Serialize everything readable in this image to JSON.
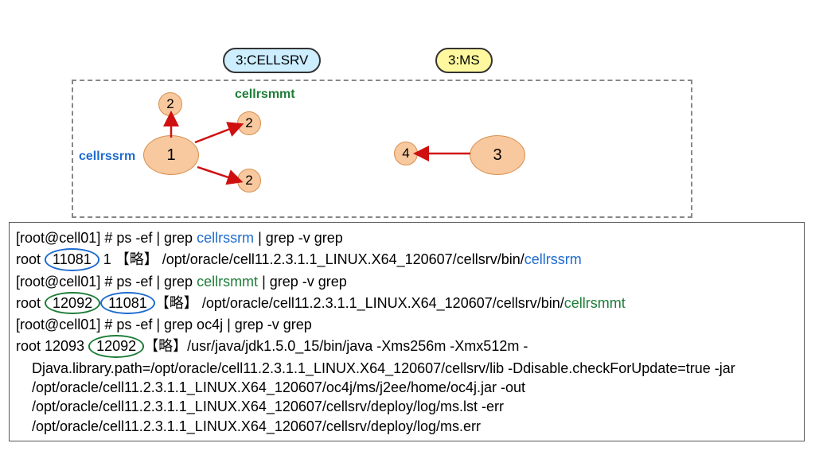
{
  "badges": {
    "cellsrv": "3:CELLSRV",
    "ms": "3:MS"
  },
  "labels": {
    "cellrssrm": "cellrssrm",
    "cellrsmmt": "cellrsmmt"
  },
  "ovals": {
    "node1": "1",
    "node2a": "2",
    "node2b": "2",
    "node2c": "2",
    "node3": "3",
    "node4": "4"
  },
  "terminal": {
    "prompt1": "[root@cell01] # ps -ef | grep ",
    "grep_cellrssrm": "cellrssrm",
    "grep_suffix": " | grep -v grep",
    "line1_user": "root    ",
    "line1_pid": "11081",
    "line1_ppid": "    1 【略】  /opt/oracle/cell11.2.3.1.1_LINUX.X64_120607/cellsrv/bin/",
    "line1_proc": "cellrssrm",
    "prompt2": "[root@cell01] # ps -ef | grep ",
    "grep_cellrsmmt": "cellrsmmt",
    "line2_user": "root    ",
    "line2_pid": "12092",
    "line2_ppid_circ": "11081",
    "line2_rest": "【略】 /opt/oracle/cell11.2.3.1.1_LINUX.X64_120607/cellsrv/bin/",
    "line2_proc": "cellrsmmt",
    "prompt3": "[root@cell01] # ps -ef | grep oc4j | grep -v grep",
    "line3_user": "root     12093  ",
    "line3_ppid_circ": "12092",
    "line3_rest": "【略】/usr/java/jdk1.5.0_15/bin/java -Xms256m -Xmx512m -",
    "line3_cont1": "Djava.library.path=/opt/oracle/cell11.2.3.1.1_LINUX.X64_120607/cellsrv/lib -Ddisable.checkForUpdate=true -jar /opt/oracle/cell11.2.3.1.1_LINUX.X64_120607/oc4j/ms/j2ee/home/oc4j.jar -out /opt/oracle/cell11.2.3.1.1_LINUX.X64_120607/cellsrv/deploy/log/ms.lst -err /opt/oracle/cell11.2.3.1.1_LINUX.X64_120607/cellsrv/deploy/log/ms.err"
  }
}
